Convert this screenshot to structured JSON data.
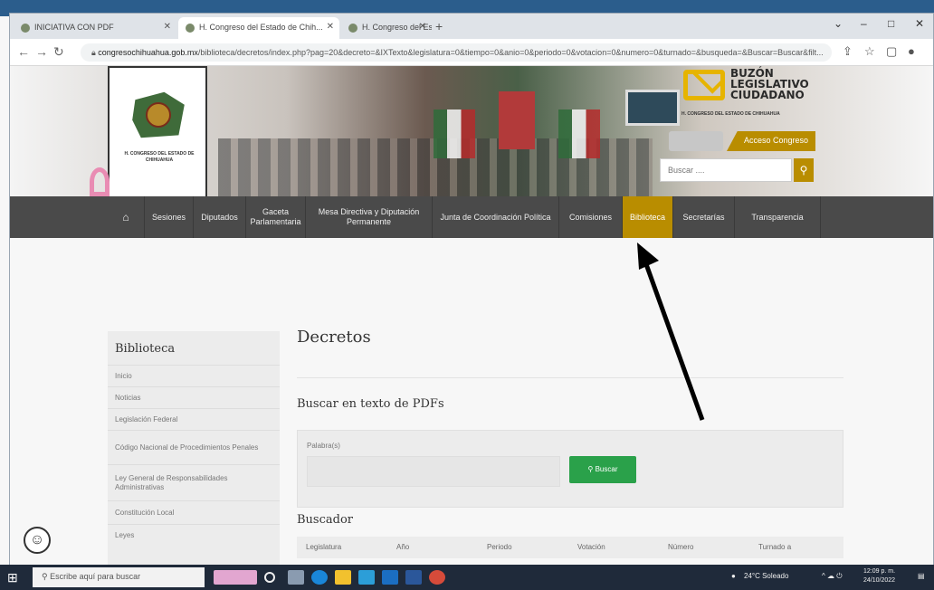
{
  "browser": {
    "tabs": [
      {
        "label": "INICIATIVA CON PDF"
      },
      {
        "label": "H. Congreso del Estado de Chih..."
      },
      {
        "label": "H. Congreso del Estado de Chih..."
      }
    ],
    "new_tab": "+",
    "url_host": "congresochihuahua.gob.mx",
    "url_path": "/biblioteca/decretos/index.php?pag=20&decreto=&IXTexto&legislatura=0&tiempo=0&anio=0&periodo=0&votacion=0&numero=0&turnado=&busqueda=&Buscar=Buscar&filt..."
  },
  "header": {
    "logo_text": "H. CONGRESO DEL ESTADO DE CHIHUAHUA",
    "buzon_title": "BUZÓN LEGISLATIVO CIUDADANO",
    "buzon_sub": "H. CONGRESO DEL ESTADO DE CHIHUAHUA",
    "access_label": "Acceso Congreso",
    "search_placeholder": "Buscar ...."
  },
  "nav": {
    "items": [
      "Sesiones",
      "Diputados",
      "Gaceta Parlamentaria",
      "Mesa Directiva y Diputación Permanente",
      "Junta de Coordinación Política",
      "Comisiones",
      "Biblioteca",
      "Secretarías",
      "Transparencia"
    ]
  },
  "sidebar": {
    "title": "Biblioteca",
    "items": [
      "Inicio",
      "Noticias",
      "Legislación Federal",
      "Código Nacional de Procedimientos Penales",
      "Ley General de Responsabilidades Administrativas",
      "Constitución Local",
      "Leyes"
    ]
  },
  "main": {
    "title": "Decretos",
    "pdf_section_title": "Buscar en texto de PDFs",
    "pdf_label": "Palabra(s)",
    "pdf_button": "Buscar",
    "search_section_title": "Buscador",
    "table_headers": [
      "Legislatura",
      "Año",
      "Periodo",
      "Votación",
      "Número",
      "Turnado a"
    ]
  },
  "taskbar": {
    "search_placeholder": "Escribe aquí para buscar",
    "weather": "24°C Soleado",
    "time": "12:09 p. m.",
    "date": "24/10/2022"
  },
  "colors": {
    "nav_bg": "#4a4a4a",
    "accent_gold": "#b98d00",
    "button_green": "#2aa14a"
  }
}
